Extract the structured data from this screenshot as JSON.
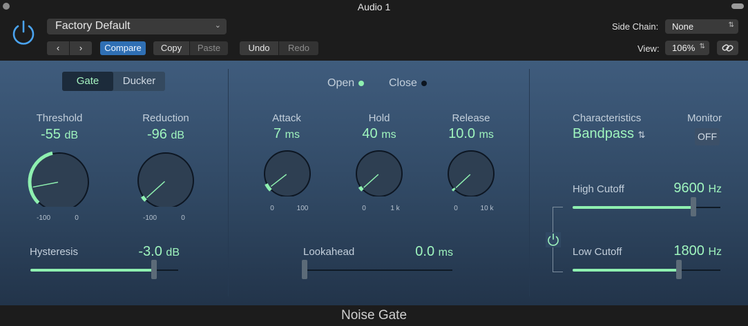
{
  "window": {
    "title": "Audio 1"
  },
  "header": {
    "preset": "Factory Default",
    "prev_label": "‹",
    "next_label": "›",
    "compare_label": "Compare",
    "copy_label": "Copy",
    "paste_label": "Paste",
    "undo_label": "Undo",
    "redo_label": "Redo",
    "side_chain_label": "Side Chain:",
    "side_chain_value": "None",
    "view_label": "View:",
    "view_value": "106%"
  },
  "gate": {
    "mode_gate": "Gate",
    "mode_ducker": "Ducker",
    "threshold": {
      "label": "Threshold",
      "value": "-55",
      "unit": "dB",
      "min": "-100",
      "max": "0",
      "level": 0.45
    },
    "reduction": {
      "label": "Reduction",
      "value": "-96",
      "unit": "dB",
      "min": "-100",
      "max": "0",
      "level": 0.04
    },
    "hysteresis": {
      "label": "Hysteresis",
      "value": "-3.0",
      "unit": "dB",
      "level": 0.85
    }
  },
  "envelope": {
    "open_label": "Open",
    "close_label": "Close",
    "attack": {
      "label": "Attack",
      "value": "7",
      "unit": "ms",
      "min": "0",
      "max": "100",
      "level": 0.07
    },
    "hold": {
      "label": "Hold",
      "value": "40",
      "unit": "ms",
      "min": "0",
      "max": "1 k",
      "level": 0.04
    },
    "release": {
      "label": "Release",
      "value": "10.0",
      "unit": "ms",
      "min": "0",
      "max": "10 k",
      "level": 0.02
    },
    "lookahead": {
      "label": "Lookahead",
      "value": "0.0",
      "unit": "ms",
      "level": 0.0
    }
  },
  "filter": {
    "characteristics_label": "Characteristics",
    "characteristics_value": "Bandpass",
    "monitor_label": "Monitor",
    "monitor_value": "OFF",
    "high_cutoff": {
      "label": "High Cutoff",
      "value": "9600",
      "unit": "Hz",
      "level": 0.83
    },
    "low_cutoff": {
      "label": "Low Cutoff",
      "value": "1800",
      "unit": "Hz",
      "level": 0.73
    }
  },
  "footer": {
    "plugin_name": "Noise Gate"
  },
  "colors": {
    "accent": "#8ef0b0",
    "compare": "#2f6fb4",
    "panel": "#3f5c7d"
  }
}
